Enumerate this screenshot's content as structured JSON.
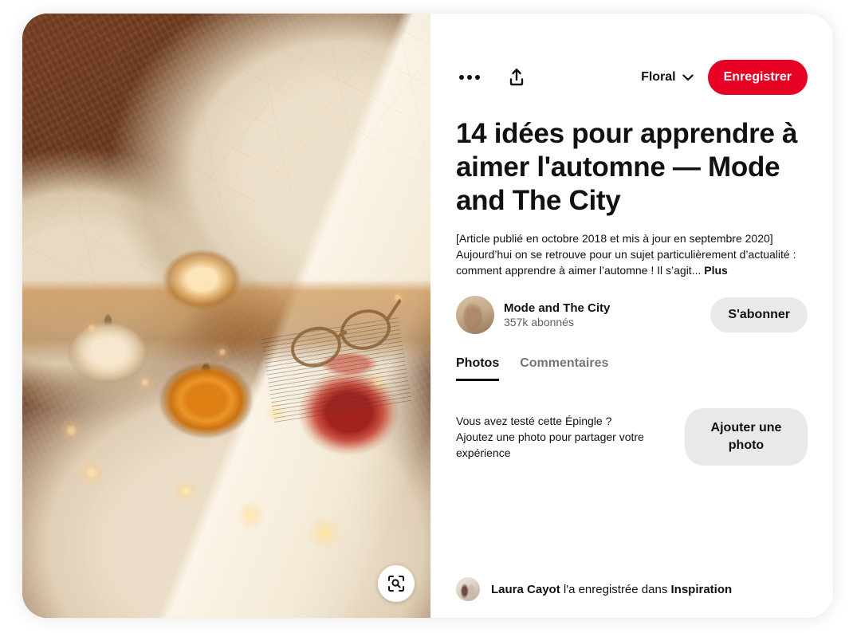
{
  "actions": {
    "more_options_icon": "ellipsis-icon",
    "share_icon": "share-icon",
    "board_name": "Floral",
    "board_chevron_icon": "chevron-down-icon",
    "save_label": "Enregistrer",
    "save_color": "#e60023"
  },
  "pin": {
    "title": "14 idées pour apprendre à aimer l'automne — Mode and The City",
    "description": "[Article publié en octobre 2018 et mis à jour en septembre 2020] Aujourd’hui on se retrouve pour un sujet particulièrement d’actualité : comment apprendre à aimer l’automne ! Il s’agit...",
    "description_more_label": "Plus",
    "visual_search_icon": "visual-search-icon"
  },
  "creator": {
    "avatar_icon": "creator-avatar-photo",
    "name": "Mode and The City",
    "followers": "357k abonnés",
    "follow_label": "S'abonner"
  },
  "tabs": [
    {
      "label": "Photos",
      "active": true
    },
    {
      "label": "Commentaires",
      "active": false
    }
  ],
  "photos_section": {
    "prompt_line1": "Vous avez testé cette Épingle ?",
    "prompt_line2": "Ajoutez une photo pour partager votre expérience",
    "add_photo_label": "Ajouter une photo"
  },
  "saved_by": {
    "avatar_icon": "saver-avatar-photo",
    "user_name": "Laura Cayot",
    "middle_text": " l'a enregistrée dans ",
    "board_name": "Inspiration"
  }
}
